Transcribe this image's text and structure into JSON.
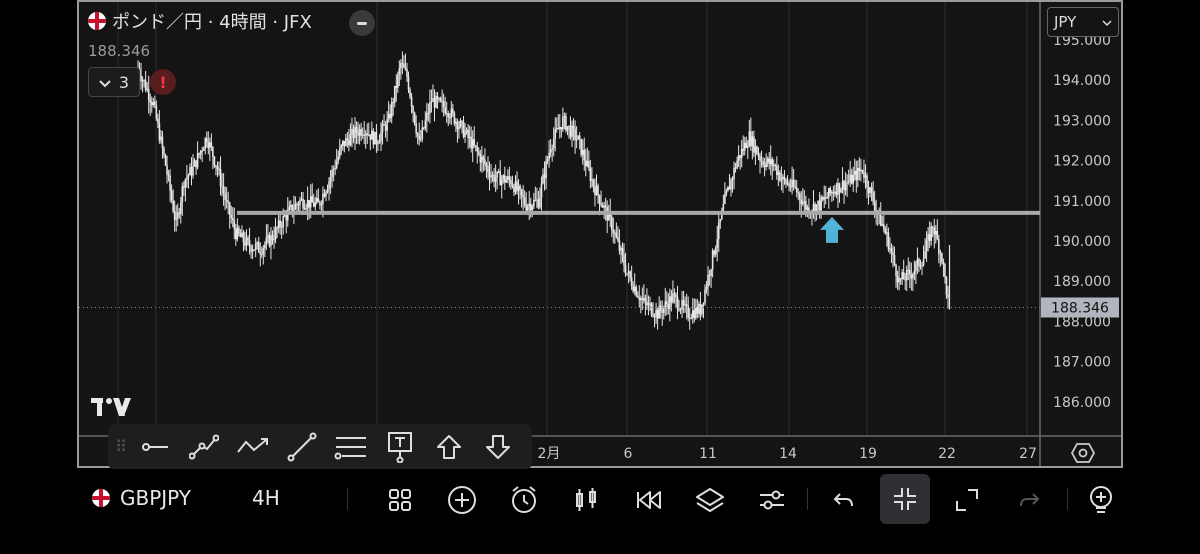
{
  "header": {
    "title": "ポンド／円 · 4時間 · JFX",
    "last_price": "188.346",
    "indicator_count": "3",
    "warning": "!"
  },
  "currency_select": {
    "value": "JPY"
  },
  "price_axis": {
    "ticks": [
      "195.000",
      "194.000",
      "193.000",
      "192.000",
      "191.000",
      "190.000",
      "189.000",
      "188.000",
      "187.000",
      "186.000"
    ],
    "current_label": "188.346",
    "current_label_bg": "#b2b5be"
  },
  "time_axis": {
    "ticks": [
      "2月",
      "6",
      "11",
      "14",
      "19",
      "22",
      "27"
    ]
  },
  "colors": {
    "candle": "#e6e6e6",
    "hline": "#a8a8a8",
    "arrow": "#4fb3d9",
    "background": "#141414",
    "grid": "#2a2a3a"
  },
  "chart_data": {
    "type": "candlestick",
    "symbol": "GBPJPY",
    "timeframe": "4H",
    "ylim": [
      185.6,
      195.3
    ],
    "horizontal_line": 190.7,
    "current_price": 188.346,
    "path_knots": [
      [
        0,
        194.3
      ],
      [
        10,
        193.4
      ],
      [
        18,
        191.9
      ],
      [
        25,
        190.4
      ],
      [
        30,
        191.5
      ],
      [
        36,
        191.8
      ],
      [
        45,
        192.6
      ],
      [
        52,
        191.8
      ],
      [
        58,
        190.9
      ],
      [
        64,
        190.2
      ],
      [
        72,
        189.9
      ],
      [
        80,
        189.8
      ],
      [
        88,
        190.1
      ],
      [
        96,
        190.6
      ],
      [
        106,
        191.0
      ],
      [
        118,
        190.9
      ],
      [
        126,
        191.6
      ],
      [
        134,
        192.4
      ],
      [
        142,
        192.7
      ],
      [
        148,
        192.8
      ],
      [
        156,
        192.5
      ],
      [
        164,
        193.0
      ],
      [
        172,
        194.4
      ],
      [
        176,
        194.1
      ],
      [
        184,
        192.4
      ],
      [
        192,
        193.5
      ],
      [
        202,
        193.3
      ],
      [
        212,
        192.8
      ],
      [
        222,
        192.2
      ],
      [
        232,
        191.6
      ],
      [
        244,
        191.5
      ],
      [
        254,
        190.9
      ],
      [
        262,
        191.0
      ],
      [
        270,
        192.4
      ],
      [
        278,
        193.0
      ],
      [
        288,
        192.5
      ],
      [
        298,
        191.4
      ],
      [
        310,
        190.4
      ],
      [
        320,
        189.2
      ],
      [
        330,
        188.5
      ],
      [
        340,
        188.2
      ],
      [
        350,
        188.6
      ],
      [
        360,
        188.2
      ],
      [
        368,
        188.3
      ],
      [
        376,
        189.6
      ],
      [
        384,
        191.0
      ],
      [
        392,
        192.0
      ],
      [
        400,
        192.6
      ],
      [
        408,
        192.0
      ],
      [
        416,
        191.9
      ],
      [
        422,
        191.5
      ],
      [
        430,
        191.3
      ],
      [
        438,
        190.8
      ],
      [
        446,
        190.9
      ],
      [
        456,
        191.3
      ],
      [
        466,
        191.5
      ],
      [
        474,
        191.8
      ],
      [
        482,
        190.9
      ],
      [
        490,
        190.1
      ],
      [
        498,
        189.0
      ],
      [
        506,
        189.2
      ],
      [
        514,
        189.6
      ],
      [
        520,
        190.4
      ],
      [
        526,
        189.6
      ],
      [
        530,
        188.5
      ]
    ]
  },
  "drawing_toolbar": {
    "tools": [
      "horizontal-ray",
      "polyline",
      "path",
      "trend-line",
      "parallel-channel",
      "text",
      "arrow-up",
      "arrow-down"
    ]
  },
  "bottom_bar": {
    "symbol": "GBPJPY",
    "timeframe": "4H",
    "icons": [
      "grid-icon",
      "add-icon",
      "alarm-icon",
      "candles-icon",
      "replay-icon",
      "layers-icon",
      "sliders-icon",
      "undo-icon",
      "collapse-icon",
      "fullscreen-icon",
      "redo-icon",
      "add-indicator-icon"
    ]
  }
}
